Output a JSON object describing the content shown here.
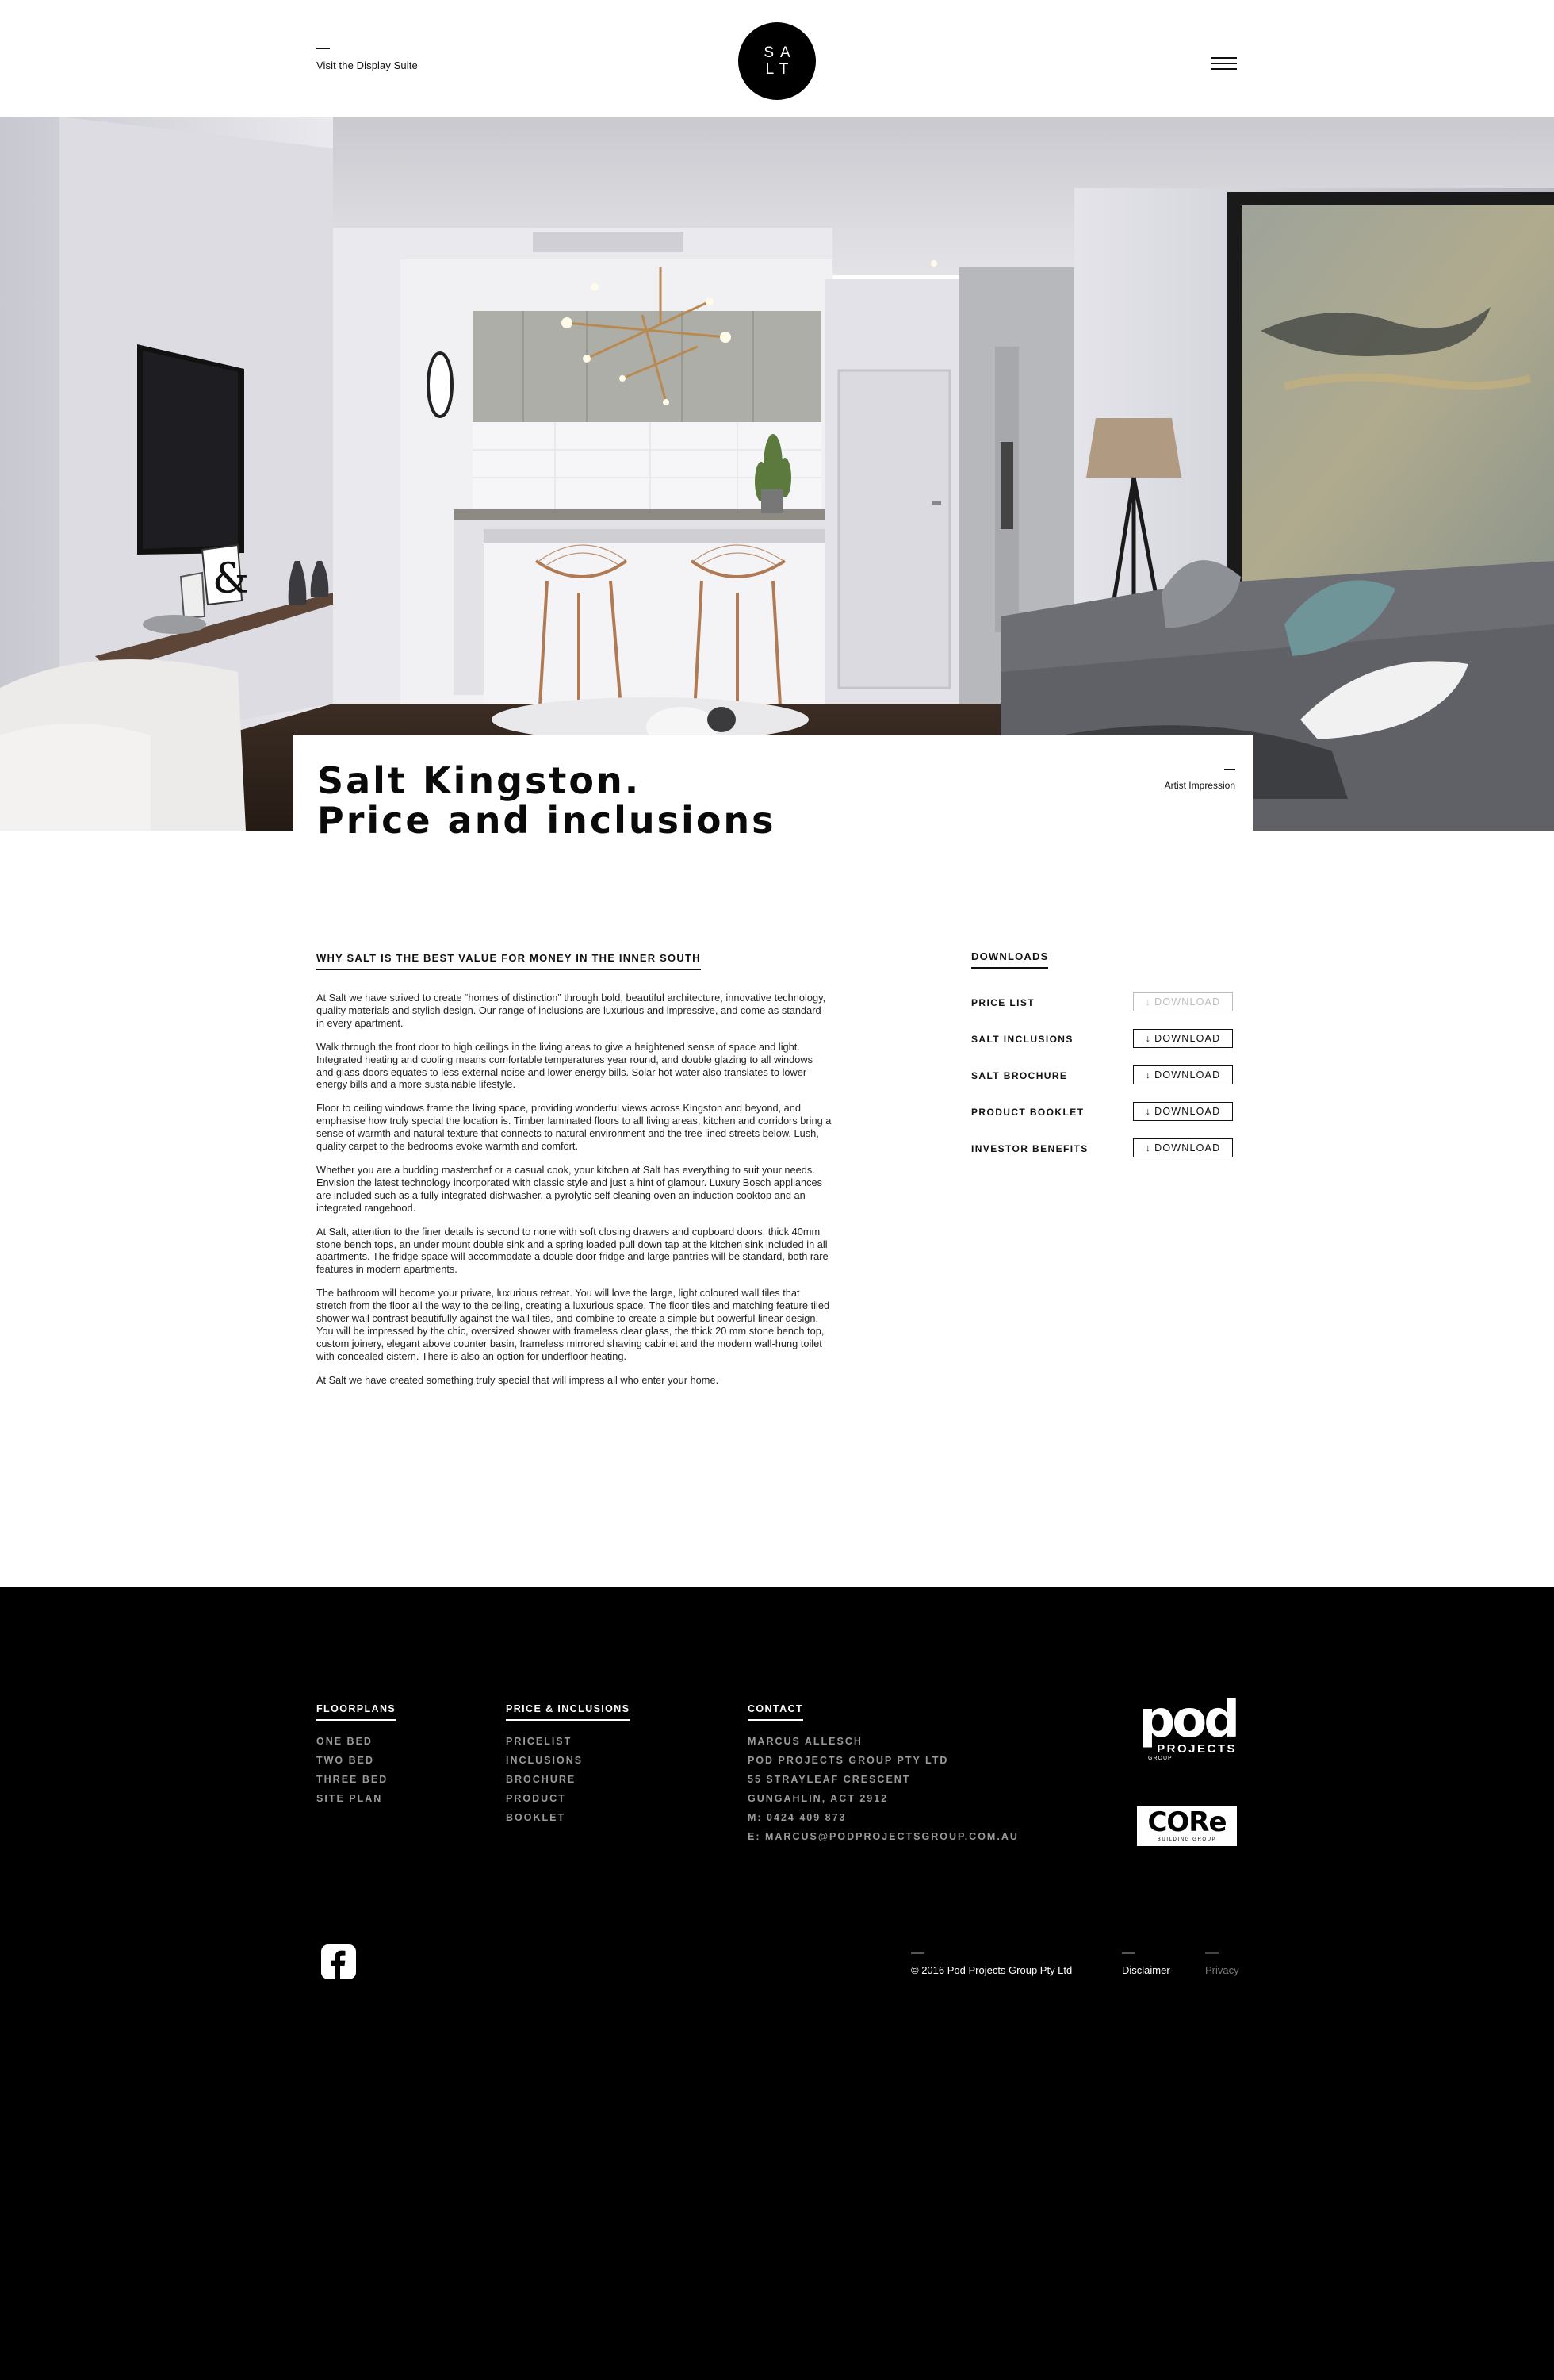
{
  "header": {
    "visit_link": "Visit the Display Suite",
    "logo_line1": "SA",
    "logo_line2": "LT"
  },
  "hero": {
    "title_line1": "Salt Kingston.",
    "title_line2": "Price and inclusions",
    "caption": "Artist Impression"
  },
  "content": {
    "heading": "WHY SALT IS THE BEST VALUE FOR MONEY IN THE INNER SOUTH",
    "paragraphs": [
      "At Salt we have strived to create “homes of distinction” through bold, beautiful architecture, innovative technology, quality materials and stylish design. Our range of inclusions are luxurious and impressive, and come as standard in every apartment.",
      "Walk through the front door to high ceilings in the living areas to give a heightened sense of space and light. Integrated heating and cooling means comfortable temperatures year round, and double glazing to all windows and glass doors equates to less external noise and lower energy bills. Solar hot water also translates to lower energy bills and a more sustainable lifestyle.",
      "Floor to ceiling windows frame the living space, providing wonderful views across Kingston and beyond, and emphasise how truly special the location is. Timber laminated floors to all living areas, kitchen and corridors bring a sense of warmth and natural texture that connects to natural environment and the tree lined streets below. Lush, quality carpet to the bedrooms evoke warmth and comfort.",
      "Whether you are a budding masterchef or a casual cook, your kitchen at Salt has everything to suit your needs. Envision the latest technology incorporated with classic style and just a hint of glamour. Luxury Bosch appliances are included such as a fully integrated dishwasher, a pyrolytic self cleaning oven an induction cooktop and an integrated rangehood.",
      "At Salt, attention to the finer details is second to none with soft closing drawers and cupboard doors, thick 40mm stone bench tops, an under mount double sink and a spring loaded pull down tap at the kitchen sink included in all apartments. The fridge space will accommodate a double door fridge and large pantries will be standard, both rare features in modern apartments.",
      "The bathroom will become your private, luxurious retreat. You will love the large, light coloured wall tiles that stretch from the floor all the way to the ceiling, creating a luxurious space. The floor tiles and matching feature tiled shower wall contrast beautifully against the wall tiles, and combine to create a simple but powerful linear design. You will be impressed by the chic, oversized shower with frameless clear glass, the thick 20 mm stone bench top, custom joinery, elegant above counter basin, frameless mirrored shaving cabinet and the modern wall-hung toilet with concealed cistern. There is also an option for underfloor heating.",
      "At Salt we have created something truly special that will impress all who enter your home."
    ]
  },
  "downloads": {
    "heading": "DOWNLOADS",
    "button_label": "DOWNLOAD",
    "items": [
      {
        "label": "PRICE LIST",
        "state": "disabled"
      },
      {
        "label": "SALT INCLUSIONS",
        "state": "active"
      },
      {
        "label": "SALT BROCHURE",
        "state": "active"
      },
      {
        "label": "PRODUCT BOOKLET",
        "state": "active"
      },
      {
        "label": "INVESTOR BENEFITS",
        "state": "active"
      }
    ]
  },
  "footer": {
    "floorplans": {
      "heading": "FLOORPLANS",
      "items": [
        "ONE BED",
        "TWO BED",
        "THREE BED",
        "SITE PLAN"
      ]
    },
    "price": {
      "heading": "PRICE & INCLUSIONS",
      "items": [
        "PRICELIST",
        "INCLUSIONS",
        "BROCHURE",
        "PRODUCT",
        "BOOKLET"
      ]
    },
    "contact": {
      "heading": "CONTACT",
      "lines": [
        "MARCUS ALLESCH",
        "POD PROJECTS GROUP PTY LTD",
        "55 STRAYLEAF CRESCENT",
        "GUNGAHLIN, ACT 2912",
        "M: 0424 409 873",
        "E: MARCUS@PODPROJECTSGROUP.COM.AU"
      ]
    },
    "pod_logo": {
      "word": "pod",
      "sub": "PROJECTS",
      "sub2": "GROUP"
    },
    "core_logo": {
      "word": "CORe",
      "sub": "BUILDING GROUP"
    },
    "copyright": "© 2016 Pod Projects Group Pty Ltd",
    "disclaimer": "Disclaimer",
    "privacy": "Privacy"
  },
  "colors": {
    "black": "#000000",
    "muted_gray": "#9a9a9a",
    "disabled_gray": "#bdbdbd"
  }
}
